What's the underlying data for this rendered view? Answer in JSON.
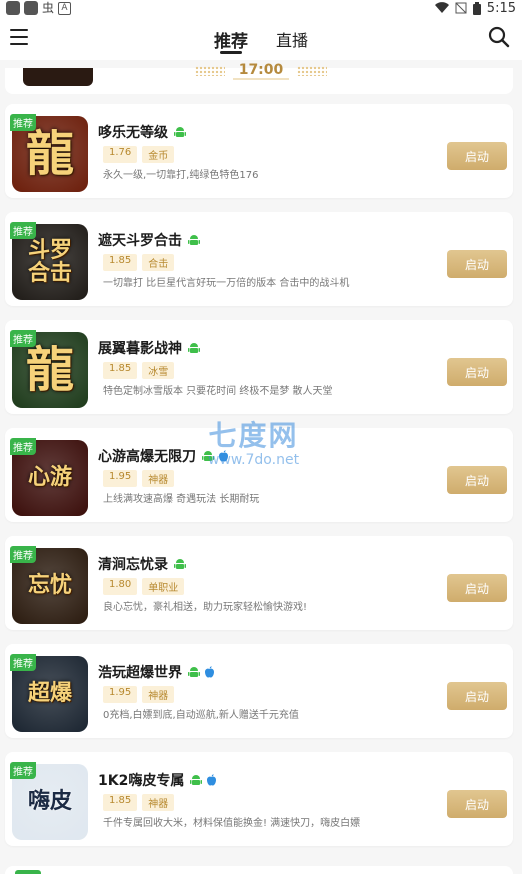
{
  "status_bar": {
    "left_glyph": "虫",
    "left_letter": "A",
    "time": "5:15"
  },
  "header": {
    "tabs": [
      {
        "label": "推荐",
        "active": true
      },
      {
        "label": "直播",
        "active": false
      }
    ]
  },
  "time_slot": "17:00",
  "watermark": {
    "cn": "七度网",
    "url": "www.7do.net"
  },
  "games": [
    {
      "badge": "推荐",
      "title": "哆乐无等级",
      "platforms": [
        "android"
      ],
      "version": "1.76",
      "tag": "金币",
      "desc": "永久一级,一切靠打,纯绿色特色176",
      "button": "启动",
      "icon_text": "龍",
      "icon_bg": "#6b1d0a"
    },
    {
      "badge": "推荐",
      "title": "遮天斗罗合击",
      "platforms": [
        "android"
      ],
      "version": "1.85",
      "tag": "合击",
      "desc": "一切靠打 比巨星代言好玩一万倍的版本 合击中的战斗机",
      "button": "启动",
      "icon_text": "斗罗合击",
      "icon_bg": "#1e1a16"
    },
    {
      "badge": "推荐",
      "title": "展翼暮影战神",
      "platforms": [
        "android"
      ],
      "version": "1.85",
      "tag": "冰雪",
      "desc": "特色定制冰雪版本 只要花时间 终极不是梦 散人天堂",
      "button": "启动",
      "icon_text": "龍",
      "icon_bg": "#1d3a1a"
    },
    {
      "badge": "推荐",
      "title": "心游高爆无限刀",
      "platforms": [
        "android",
        "ios"
      ],
      "version": "1.95",
      "tag": "神器",
      "desc": "上线满攻速高爆 奇遇玩法 长期耐玩",
      "button": "启动",
      "icon_text": "心游",
      "icon_bg": "#3a0d0a"
    },
    {
      "badge": "推荐",
      "title": "清涧忘忧录",
      "platforms": [
        "android"
      ],
      "version": "1.80",
      "tag": "单职业",
      "desc": "良心忘忧，豪礼相送，助力玩家轻松愉快游戏!",
      "button": "启动",
      "icon_text": "忘忧",
      "icon_bg": "#2a1a0e"
    },
    {
      "badge": "推荐",
      "title": "浩玩超爆世界",
      "platforms": [
        "android",
        "ios"
      ],
      "version": "1.95",
      "tag": "神器",
      "desc": "0充档,白嫖到底,自动巡航,新人赠送千元充值",
      "button": "启动",
      "icon_text": "超爆",
      "icon_bg": "#1a2430"
    },
    {
      "badge": "推荐",
      "title": "1K2嗨皮专属",
      "platforms": [
        "android",
        "ios"
      ],
      "version": "1.85",
      "tag": "神器",
      "desc": "千件专属回收大米，材料保值能换金! 满速快刀，嗨皮白嫖",
      "button": "启动",
      "icon_text": "嗨皮",
      "icon_bg": "#dfe7ef"
    }
  ],
  "colors": {
    "badge_green": "#39b44a",
    "launch_gold": "#d8b87c",
    "tag_bg": "#fbf0d8",
    "tag_text": "#b7892f"
  }
}
